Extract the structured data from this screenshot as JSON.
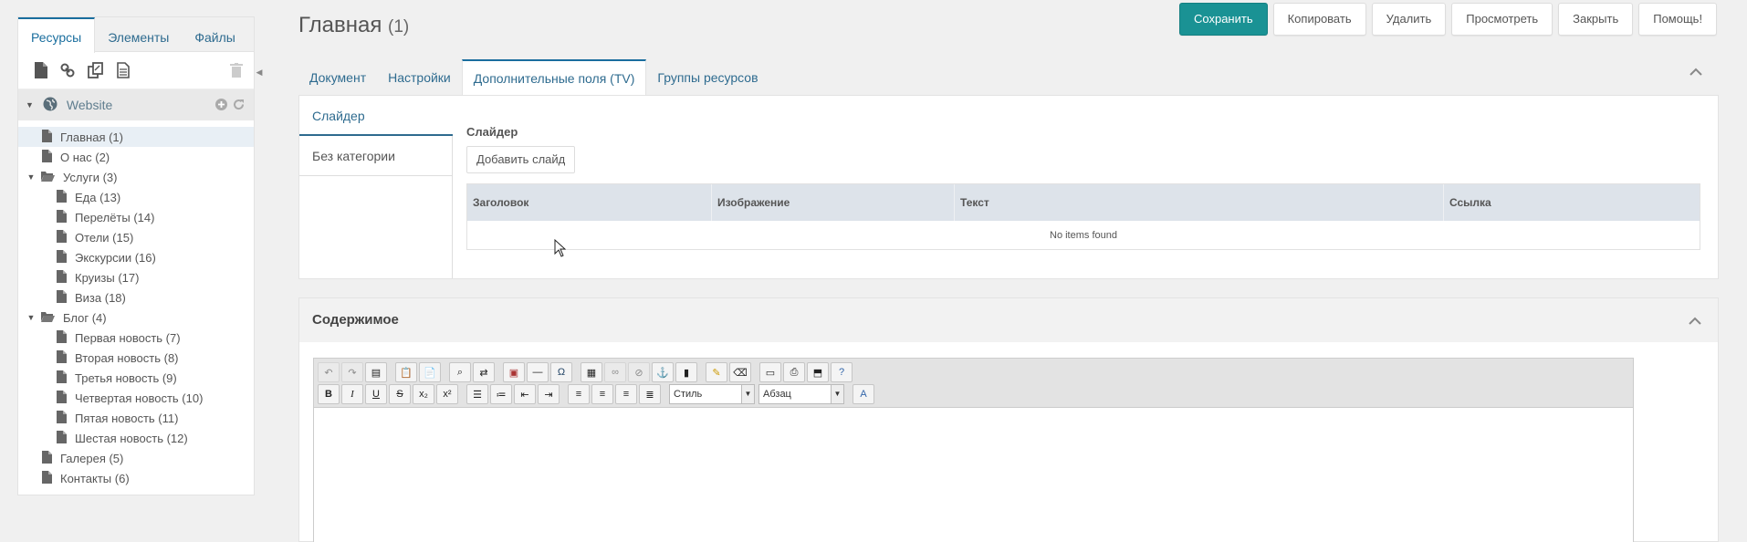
{
  "sidebar": {
    "tabs": [
      "Ресурсы",
      "Элементы",
      "Файлы"
    ],
    "root": "Website",
    "tree": [
      {
        "label": "Главная (1)",
        "level": 0,
        "type": "doc",
        "selected": true
      },
      {
        "label": "О нас (2)",
        "level": 0,
        "type": "doc"
      },
      {
        "label": "Услуги (3)",
        "level": 0,
        "type": "folder"
      },
      {
        "label": "Еда (13)",
        "level": 1,
        "type": "doc"
      },
      {
        "label": "Перелёты (14)",
        "level": 1,
        "type": "doc"
      },
      {
        "label": "Отели (15)",
        "level": 1,
        "type": "doc"
      },
      {
        "label": "Экскурсии (16)",
        "level": 1,
        "type": "doc"
      },
      {
        "label": "Круизы (17)",
        "level": 1,
        "type": "doc"
      },
      {
        "label": "Виза (18)",
        "level": 1,
        "type": "doc"
      },
      {
        "label": "Блог (4)",
        "level": 0,
        "type": "folder"
      },
      {
        "label": "Первая новость (7)",
        "level": 1,
        "type": "doc"
      },
      {
        "label": "Вторая новость (8)",
        "level": 1,
        "type": "doc"
      },
      {
        "label": "Третья новость (9)",
        "level": 1,
        "type": "doc"
      },
      {
        "label": "Четвертая новость (10)",
        "level": 1,
        "type": "doc"
      },
      {
        "label": "Пятая новость (11)",
        "level": 1,
        "type": "doc"
      },
      {
        "label": "Шестая новость (12)",
        "level": 1,
        "type": "doc"
      },
      {
        "label": "Галерея (5)",
        "level": 0,
        "type": "doc"
      },
      {
        "label": "Контакты (6)",
        "level": 0,
        "type": "doc"
      }
    ]
  },
  "header": {
    "title": "Главная",
    "id_label": "(1)",
    "buttons": [
      "Сохранить",
      "Копировать",
      "Удалить",
      "Просмотреть",
      "Закрыть",
      "Помощь!"
    ]
  },
  "tabs": [
    "Документ",
    "Настройки",
    "Дополнительные поля (TV)",
    "Группы ресурсов"
  ],
  "tv": {
    "categories": [
      "Слайдер",
      "Без категории"
    ],
    "field_label": "Слайдер",
    "add_button": "Добавить слайд",
    "columns": [
      "Заголовок",
      "Изображение",
      "Текст",
      "Ссылка"
    ],
    "empty_text": "No items found"
  },
  "content": {
    "title": "Содержимое",
    "style_select": "Стиль",
    "format_select": "Абзац"
  },
  "colors": {
    "primary": "#1a9294",
    "link": "#2e6b8f"
  }
}
